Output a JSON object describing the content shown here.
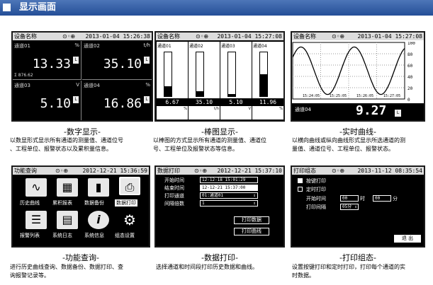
{
  "header": {
    "title": "显示画面"
  },
  "screens": {
    "digital": {
      "title": "设备名称",
      "time": "2013-01-04 15:26:38",
      "channels": [
        {
          "name": "通道01",
          "unit": "%",
          "value": "13.33",
          "flag": "L",
          "extra": "Σ 876.62"
        },
        {
          "name": "通道02",
          "unit": "t/h",
          "value": "35.10",
          "flag": "L",
          "extra": ""
        },
        {
          "name": "通道03",
          "unit": "V",
          "value": "5.10",
          "flag": "L",
          "extra": ""
        },
        {
          "name": "通道04",
          "unit": "%",
          "value": "16.86",
          "flag": "L",
          "extra": ""
        }
      ],
      "caption": "-数字显示-",
      "desc": [
        "以数显形式显示所有通道的测量值、通道位号",
        "、工程单位、报警状态以及累积量信息。"
      ]
    },
    "bar": {
      "title": "设备名称",
      "time": "2013-01-04 15:27:08",
      "channels": [
        {
          "name": "通道01",
          "value": "6.67",
          "unit": "%",
          "fill": 0.22
        },
        {
          "name": "通道02",
          "value": "35.10",
          "unit": "t/h",
          "fill": 0.12
        },
        {
          "name": "通道03",
          "value": "5.10",
          "unit": "V",
          "fill": 0.05
        },
        {
          "name": "通道04",
          "value": "11.96",
          "unit": "%",
          "fill": 0.5
        }
      ],
      "caption": "-棒图显示-",
      "desc": [
        "以棒图的方式显示所有通道的测量值、通道位",
        "号、工程单位及报警状态等信息。"
      ]
    },
    "curve": {
      "title": "设备名称",
      "time": "2013-01-04 15:27:08",
      "ticks_y": [
        "100",
        "80",
        "60",
        "40",
        "20",
        "0"
      ],
      "ticks_x": [
        "15:24:05",
        "15:25:05",
        "15:26:05",
        "15:27:05"
      ],
      "channel": "通道04",
      "value": "9.27",
      "unit": "L",
      "caption": "-实时曲线-",
      "desc": [
        "以横向曲线或纵向曲线形式显示所选通道的测",
        "量值、通道位号、工程单位、报警状态。"
      ]
    },
    "func": {
      "title": "功能查询",
      "time": "2012-12-21 15:36:59",
      "items": [
        {
          "label": "历史曲线",
          "icon": "∿"
        },
        {
          "label": "累积报表",
          "icon": "▦"
        },
        {
          "label": "数据备份",
          "icon": "▮"
        },
        {
          "label": "数据打印",
          "icon": "⎙"
        },
        {
          "label": "报警列表",
          "icon": "☰"
        },
        {
          "label": "系统日志",
          "icon": "▤"
        },
        {
          "label": "系统信息",
          "icon": "i"
        },
        {
          "label": "组态设置",
          "icon": "⚙"
        }
      ],
      "caption": "-功能查询-",
      "desc": [
        "进行历史曲线查询、数据备份、数据打印、查",
        "询报警记录等。"
      ]
    },
    "print": {
      "title": "数据打印",
      "time": "2012-12-21 15:37:10",
      "rows": [
        {
          "label": "开始时间",
          "value": "12-12-18 15:01:29"
        },
        {
          "label": "结束时间",
          "value": "12-12-21 15:37:00"
        },
        {
          "label": "打印通道",
          "value": "01:通道01"
        },
        {
          "label": "间隔倍数",
          "value": "1"
        }
      ],
      "btn_data": "打印数据",
      "btn_curve": "打印曲线",
      "caption": "-数据打印-",
      "desc": [
        "选择通道和时间段打印历史数据和曲线。"
      ]
    },
    "printcfg": {
      "title": "打印组态",
      "time": "2013-11-12 08:35:54",
      "opt1": "按键打印",
      "opt2": "定时打印",
      "start_label": "开始时间",
      "start_h": "00",
      "h_unit": "时",
      "start_m": "00",
      "m_unit": "分",
      "interval_label": "打印间隔",
      "interval_val": "05分",
      "exit": "退 出",
      "caption": "-打印组态-",
      "desc": [
        "设置按键打印和定时打印，打印每个通道的实",
        "时数据。"
      ]
    }
  }
}
